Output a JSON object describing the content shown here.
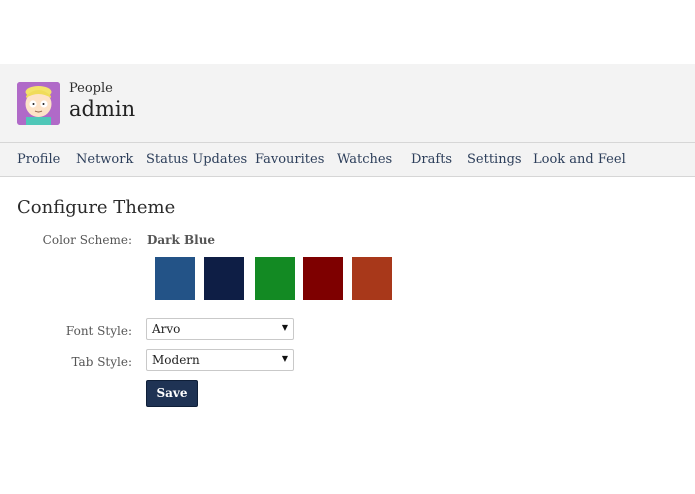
{
  "header": {
    "breadcrumb": "People",
    "title": "admin"
  },
  "nav": {
    "items": [
      "Profile",
      "Network",
      "Status Updates",
      "Favourites",
      "Watches",
      "Drafts",
      "Settings",
      "Look and Feel"
    ]
  },
  "page": {
    "heading": "Configure Theme"
  },
  "color_scheme": {
    "label": "Color Scheme:",
    "selected": "Dark Blue",
    "swatches": [
      "#235387",
      "#0e1e45",
      "#138a23",
      "#7e0000",
      "#a8381a"
    ]
  },
  "font_style": {
    "label": "Font Style:",
    "value": "Arvo"
  },
  "tab_style": {
    "label": "Tab Style:",
    "value": "Modern"
  },
  "actions": {
    "save_label": "Save"
  }
}
